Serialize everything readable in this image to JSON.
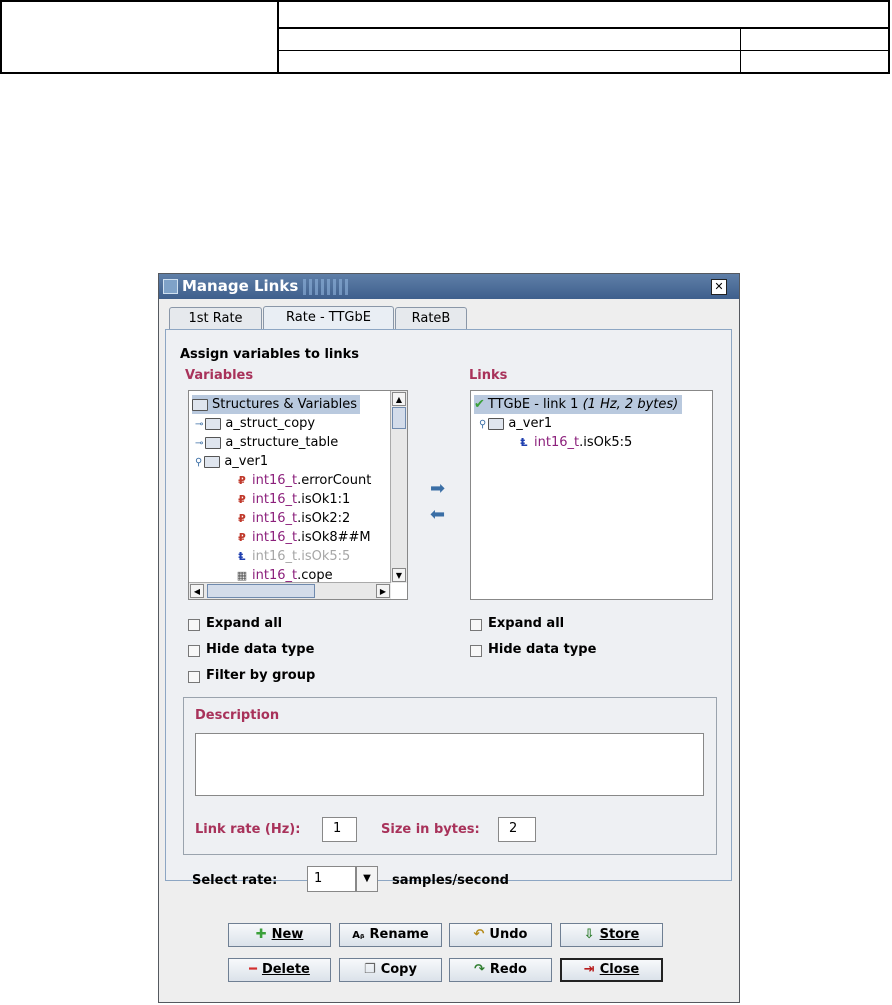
{
  "dialog": {
    "title": "Manage Links",
    "close_symbol": "✕"
  },
  "tabs": [
    {
      "label": "1st Rate"
    },
    {
      "label": "Rate - TTGbE"
    },
    {
      "label": "RateB"
    }
  ],
  "panel": {
    "heading": "Assign variables to links",
    "variables_label": "Variables",
    "links_label": "Links"
  },
  "variables_tree": [
    {
      "text": "Structures & Variables"
    },
    {
      "text": "a_struct_copy"
    },
    {
      "text": "a_structure_table"
    },
    {
      "text": "a_ver1"
    },
    {
      "type": "int16_t",
      "name": ".errorCount"
    },
    {
      "type": "int16_t",
      "name": ".isOk1:1"
    },
    {
      "type": "int16_t",
      "name": ".isOk2:2"
    },
    {
      "type": "int16_t",
      "name": ".isOk8##M"
    },
    {
      "type": "int16_t",
      "name": ".isOk5:5"
    },
    {
      "type": "int16_t",
      "name": ".cope"
    }
  ],
  "links_tree": [
    {
      "text": "TTGbE - link 1 ",
      "detail": "(1 Hz, 2 bytes)"
    },
    {
      "text": "a_ver1"
    },
    {
      "type": "int16_t",
      "name": ".isOk5:5"
    }
  ],
  "options_left": {
    "expand_all": "Expand all",
    "hide_data_type": "Hide data type",
    "filter_by_group": "Filter by group"
  },
  "options_right": {
    "expand_all": "Expand all",
    "hide_data_type": "Hide data type"
  },
  "description": {
    "label": "Description",
    "text": "",
    "link_rate_label": "Link rate (Hz):",
    "link_rate_value": "1",
    "size_label": "Size in bytes:",
    "size_value": "2"
  },
  "rate": {
    "label": "Select rate:",
    "value": "1",
    "unit": "samples/second"
  },
  "buttons": {
    "new": "New",
    "rename": "Rename",
    "undo": "Undo",
    "store": "Store",
    "delete": "Delete",
    "copy": "Copy",
    "redo": "Redo",
    "close": "Close"
  },
  "colors": {
    "accent_label": "#a8325a",
    "type_purple": "#8b1f7b",
    "titlebar": "#4a6b95",
    "arrow_blue": "#3a6ea5",
    "check_green": "#3aa03a"
  },
  "icons": [
    "move-right-arrow-icon",
    "move-left-arrow-icon",
    "folder-icon",
    "check-icon",
    "variable-icon"
  ]
}
